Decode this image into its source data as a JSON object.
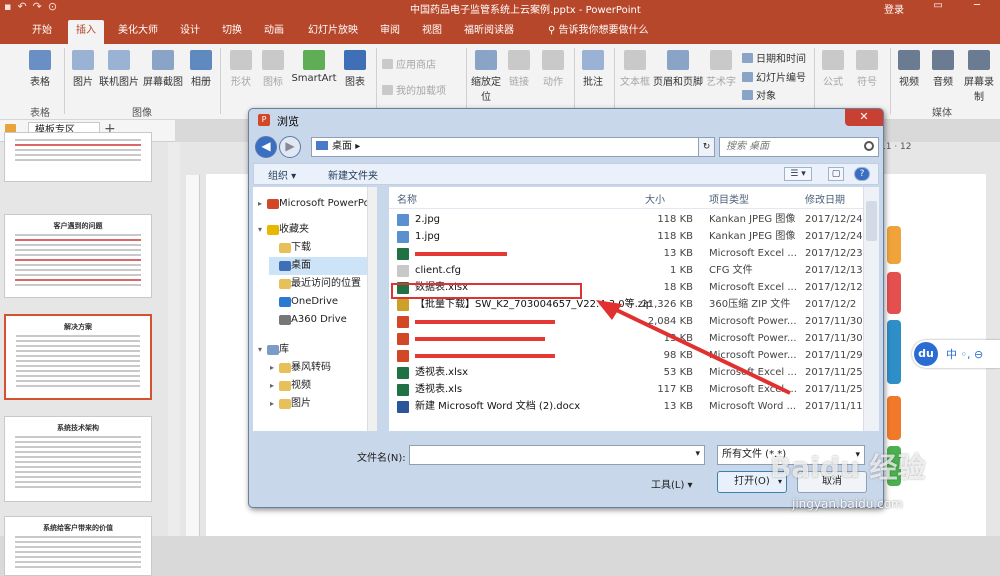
{
  "window": {
    "title": "中国药品电子监管系统上云案例.pptx - PowerPoint",
    "login": "登录"
  },
  "ribbon_tabs": [
    "开始",
    "插入",
    "美化大师",
    "设计",
    "切换",
    "动画",
    "幻灯片放映",
    "审阅",
    "视图",
    "福昕阅读器"
  ],
  "active_tab": "插入",
  "tell_me": "告诉我你想要做什么",
  "ribbon": {
    "table": "表格",
    "picture": "图片",
    "online_picture": "联机图片",
    "screenshot": "屏幕截图",
    "album": "相册",
    "shapes": "形状",
    "icons": "图标",
    "smartart": "SmartArt",
    "chart": "图表",
    "store": "应用商店",
    "my_addins": "我的加载项",
    "zoom": "缩放定位",
    "link": "链接",
    "action": "动作",
    "comment": "批注",
    "textbox": "文本框",
    "header_footer": "页眉和页脚",
    "wordart": "艺术字",
    "datetime": "日期和时间",
    "slide_number": "幻灯片编号",
    "object": "对象",
    "equation": "公式",
    "symbol": "符号",
    "video": "视频",
    "audio": "音频",
    "screen_record": "屏幕录制",
    "group_table": "表格",
    "group_image": "图像",
    "group_media": "媒体"
  },
  "doc_tab": "模板专区",
  "slides": [
    {
      "title": ""
    },
    {
      "title": "客户遇到的问题"
    },
    {
      "title": "解决方案"
    },
    {
      "title": "系统技术架构"
    },
    {
      "title": "系统给客户带来的价值"
    }
  ],
  "right_panel": {
    "ruler_text": "11 · 12",
    "du_logo": "du",
    "du_text": "中 ◦, ⊖"
  },
  "dialog": {
    "title": "浏览",
    "close": "✕",
    "back": "◀",
    "forward": "▶",
    "address": "桌面",
    "address_sep": "▸",
    "search_placeholder": "搜索 桌面",
    "organize": "组织 ▾",
    "new_folder": "新建文件夹",
    "view_icon": "☰ ▾",
    "pane_icon": "▢",
    "help_icon": "?",
    "nav": [
      {
        "label": "Microsoft PowerPoint",
        "type": "ppt",
        "indent": 0,
        "arrow": "▸"
      },
      {
        "label": "收藏夹",
        "type": "star",
        "indent": 0,
        "arrow": "▾"
      },
      {
        "label": "下载",
        "type": "folder",
        "indent": 1,
        "arrow": ""
      },
      {
        "label": "桌面",
        "type": "desktop",
        "indent": 1,
        "arrow": ""
      },
      {
        "label": "最近访问的位置",
        "type": "folder",
        "indent": 1,
        "arrow": ""
      },
      {
        "label": "OneDrive",
        "type": "cloud",
        "indent": 1,
        "arrow": ""
      },
      {
        "label": "A360 Drive",
        "type": "drive",
        "indent": 1,
        "arrow": ""
      },
      {
        "label": "库",
        "type": "lib",
        "indent": 0,
        "arrow": "▾"
      },
      {
        "label": "暴风转码",
        "type": "folder",
        "indent": 1,
        "arrow": "▸"
      },
      {
        "label": "视频",
        "type": "folder",
        "indent": 1,
        "arrow": "▸"
      },
      {
        "label": "图片",
        "type": "folder",
        "indent": 1,
        "arrow": "▸"
      }
    ],
    "columns": {
      "name": "名称",
      "size": "大小",
      "type": "项目类型",
      "modified": "修改日期"
    },
    "files": [
      {
        "name": "2.jpg",
        "size": "118 KB",
        "type": "Kankan JPEG 图像",
        "date": "2017/12/24",
        "icon": "jpg",
        "redacted": false
      },
      {
        "name": "1.jpg",
        "size": "118 KB",
        "type": "Kankan JPEG 图像",
        "date": "2017/12/24",
        "icon": "jpg",
        "redacted": false
      },
      {
        "name": "",
        "size": "13 KB",
        "type": "Microsoft Excel ...",
        "date": "2017/12/23",
        "icon": "xls",
        "redacted": true
      },
      {
        "name": "client.cfg",
        "size": "1 KB",
        "type": "CFG 文件",
        "date": "2017/12/13",
        "icon": "cfg",
        "redacted": false
      },
      {
        "name": "数据表.xlsx",
        "size": "18 KB",
        "type": "Microsoft Excel ...",
        "date": "2017/12/12",
        "icon": "xls",
        "redacted": false
      },
      {
        "name": "【批量下载】SW_K2_703004657_V22.4.3.0等.zip",
        "size": "21,326 KB",
        "type": "360压缩 ZIP 文件",
        "date": "2017/12/2",
        "icon": "zip",
        "redacted": false
      },
      {
        "name": "",
        "size": "2,084 KB",
        "type": "Microsoft Power...",
        "date": "2017/11/30",
        "icon": "ppt",
        "redacted": true
      },
      {
        "name": "",
        "size": "13 KB",
        "type": "Microsoft Power...",
        "date": "2017/11/30",
        "icon": "ppt",
        "redacted": true
      },
      {
        "name": "",
        "size": "98 KB",
        "type": "Microsoft Power...",
        "date": "2017/11/29",
        "icon": "ppt",
        "redacted": true
      },
      {
        "name": "透视表.xlsx",
        "size": "53 KB",
        "type": "Microsoft Excel ...",
        "date": "2017/11/25",
        "icon": "xls",
        "redacted": false
      },
      {
        "name": "透视表.xls",
        "size": "117 KB",
        "type": "Microsoft Excel ...",
        "date": "2017/11/25",
        "icon": "xls",
        "redacted": false
      },
      {
        "name": "新建 Microsoft Word 文档 (2).docx",
        "size": "13 KB",
        "type": "Microsoft Word ...",
        "date": "2017/11/11",
        "icon": "doc",
        "redacted": false
      }
    ],
    "filename_label": "文件名(N):",
    "filename_value": "",
    "filetype_value": "所有文件 (*.*)",
    "tools": "工具(L) ▾",
    "open": "打开(O)",
    "cancel": "取消"
  },
  "watermark": {
    "text": "Baidu 经验",
    "url": "jingyan.baidu.com"
  },
  "colors": {
    "accent": "#b7472a",
    "highlight": "#dd3333",
    "excel": "#1f7244",
    "ppt": "#d24726"
  }
}
